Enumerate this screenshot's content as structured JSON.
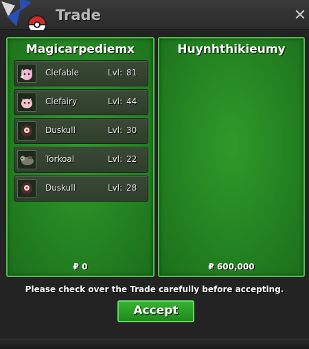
{
  "window": {
    "title": "Trade",
    "close_label": "✕",
    "logo_icon": "pokeball-logo-icon"
  },
  "left_panel": {
    "player": "Magicarpediemx",
    "money_symbol": "₽",
    "money": "0",
    "pokemon": [
      {
        "name": "Clefable",
        "lvl_label": "Lvl:",
        "lvl": "81",
        "icon": "clefable-sprite-icon"
      },
      {
        "name": "Clefairy",
        "lvl_label": "Lvl:",
        "lvl": "44",
        "icon": "clefairy-sprite-icon"
      },
      {
        "name": "Duskull",
        "lvl_label": "Lvl:",
        "lvl": "30",
        "icon": "duskull-sprite-icon"
      },
      {
        "name": "Torkoal",
        "lvl_label": "Lvl:",
        "lvl": "22",
        "icon": "torkoal-sprite-icon"
      },
      {
        "name": "Duskull",
        "lvl_label": "Lvl:",
        "lvl": "28",
        "icon": "duskull-sprite-icon"
      }
    ]
  },
  "right_panel": {
    "player": "Huynhthikieumy",
    "money_symbol": "₽",
    "money": "600,000",
    "pokemon": []
  },
  "notice": "Please check over the Trade carefully before accepting.",
  "accept_label": "Accept",
  "colors": {
    "panel_green": "#248322",
    "panel_border": "#4fc24a",
    "button_green": "#2aa027"
  }
}
